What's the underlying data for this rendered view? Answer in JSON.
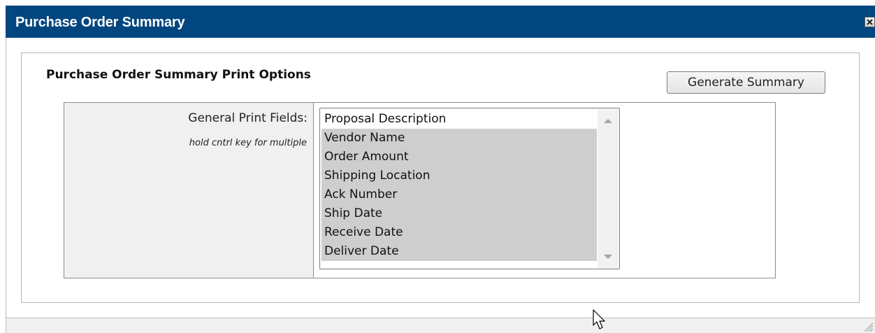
{
  "dialog": {
    "title": "Purchase Order Summary",
    "close_icon": "close-icon"
  },
  "panel": {
    "section_title": "Purchase Order Summary Print Options",
    "generate_button": "Generate Summary",
    "field_label": "General Print Fields:",
    "hint": "hold cntrl key for multiple"
  },
  "print_fields": {
    "options": [
      {
        "label": "Proposal Description",
        "selected": false
      },
      {
        "label": "Vendor Name",
        "selected": true
      },
      {
        "label": "Order Amount",
        "selected": true
      },
      {
        "label": "Shipping Location",
        "selected": true
      },
      {
        "label": "Ack Number",
        "selected": true
      },
      {
        "label": "Ship Date",
        "selected": true
      },
      {
        "label": "Receive Date",
        "selected": true
      },
      {
        "label": "Deliver Date",
        "selected": true
      }
    ]
  },
  "colors": {
    "titlebar": "#01467f",
    "selection": "#cecece"
  }
}
